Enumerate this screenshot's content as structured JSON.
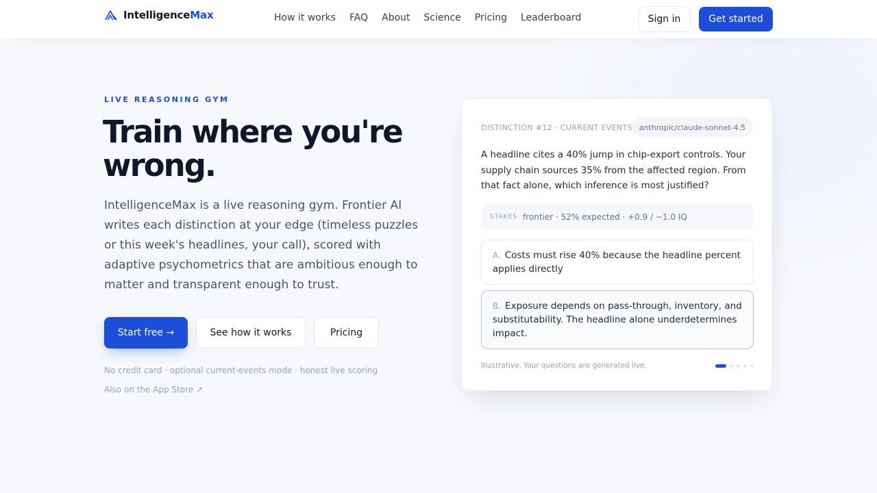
{
  "brand": {
    "name_part1": "Intelligence",
    "name_part2": "Max",
    "accent": "#1d4ed8"
  },
  "nav": {
    "items": [
      {
        "label": "How it works"
      },
      {
        "label": "FAQ"
      },
      {
        "label": "About"
      },
      {
        "label": "Science"
      },
      {
        "label": "Pricing"
      },
      {
        "label": "Leaderboard"
      }
    ],
    "sign_in": "Sign in",
    "get_started": "Get started"
  },
  "hero": {
    "eyebrow": "LIVE REASONING GYM",
    "headline_line1": "Train where you're",
    "headline_line2": "wrong.",
    "lede": "IntelligenceMax is a live reasoning gym. Frontier AI writes each distinction at your edge (timeless puzzles or this week's headlines, your call), scored with adaptive psychometrics that are ambitious enough to matter and transparent enough to trust.",
    "cta_primary": "Start free →",
    "cta_how": "See how it works",
    "cta_pricing": "Pricing",
    "fine_print": "No credit card · optional current-events mode · honest live scoring",
    "app_store": "Also on the App Store ↗"
  },
  "card": {
    "meta": "DISTINCTION #12 · CURRENT EVENTS",
    "model": "anthropic/claude-sonnet-4.5",
    "question": "A headline cites a 40% jump in chip-export controls. Your supply chain sources 35% from the affected region. From that fact alone, which inference is most justified?",
    "stakes_label": "STAKES",
    "stakes_text": "frontier · 52% expected · +0.9 / −1.0 IQ",
    "options": [
      {
        "letter": "A.",
        "text": "Costs must rise 40% because the headline percent applies directly"
      },
      {
        "letter": "B.",
        "text": "Exposure depends on pass-through, inventory, and substitutability. The headline alone underdetermines impact."
      }
    ],
    "note": "Illustrative. Your questions are generated live.",
    "pagination": {
      "current": 1,
      "total": 5
    }
  }
}
